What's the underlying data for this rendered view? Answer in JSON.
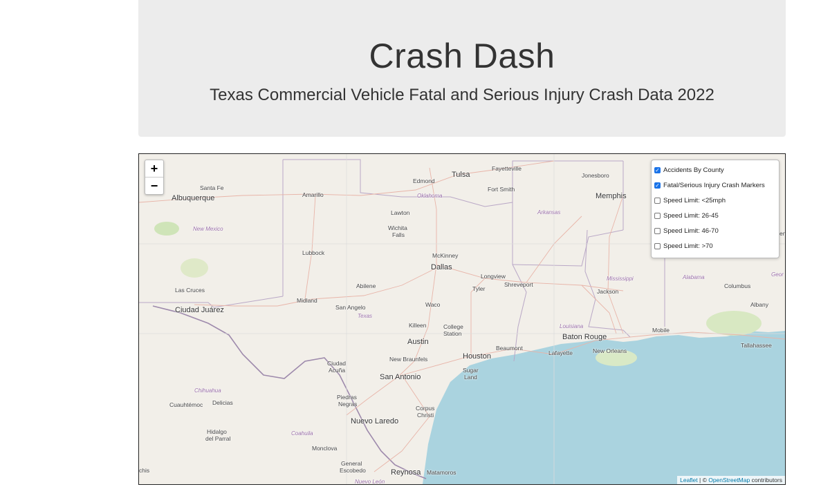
{
  "header": {
    "title": "Crash Dash",
    "subtitle": "Texas Commercial Vehicle Fatal and Serious Injury Crash Data 2022"
  },
  "map": {
    "zoom_in": "+",
    "zoom_out": "−",
    "layers": [
      {
        "label": "Accidents By County",
        "checked": true
      },
      {
        "label": "Fatal/Serious Injury Crash Markers",
        "checked": true
      },
      {
        "label": "Speed Limit: <25mph",
        "checked": false
      },
      {
        "label": "Speed Limit: 26-45",
        "checked": false
      },
      {
        "label": "Speed Limit: 46-70",
        "checked": false
      },
      {
        "label": "Speed Limit: >70",
        "checked": false
      }
    ],
    "attribution": {
      "leaflet": "Leaflet",
      "sep": " | © ",
      "osm": "OpenStreetMap",
      "suffix": " contributors"
    },
    "places": {
      "fayetteville": "Fayetteville",
      "tulsa": "Tulsa",
      "edmond": "Edmond",
      "oklahoma": "Oklahoma",
      "fort_smith": "Fort Smith",
      "jonesboro": "Jonesboro",
      "memphis": "Memphis",
      "santa_fe": "Santa Fe",
      "albuquerque": "Albuquerque",
      "amarillo": "Amarillo",
      "new_mexico": "New Mexico",
      "lawton": "Lawton",
      "wichita_falls_1": "Wichita",
      "wichita_falls_2": "Falls",
      "arkansas": "Arkansas",
      "mckinney": "McKinney",
      "lubbock": "Lubbock",
      "dallas": "Dallas",
      "longview": "Longview",
      "shreveport": "Shreveport",
      "mississippi": "Mississippi",
      "alabama": "Alabama",
      "las_cruces": "Las Cruces",
      "abilene": "Abilene",
      "tyler": "Tyler",
      "jackson": "Jackson",
      "columbus": "Columbus",
      "midland": "Midland",
      "ciudad_juarez": "Ciudad Juárez",
      "san_angelo": "San Angelo",
      "waco": "Waco",
      "texas": "Texas",
      "albany": "Albany",
      "killeen": "Killeen",
      "college_station_1": "College",
      "college_station_2": "Station",
      "louisiana": "Louisiana",
      "mobile": "Mobile",
      "baton_rouge": "Baton Rouge",
      "tallahassee": "Tallahassee",
      "austin": "Austin",
      "beaumont": "Beaumont",
      "lafayette": "Lafayette",
      "new_orleans": "New Orleans",
      "ciudad_acuna_1": "Ciudad",
      "ciudad_acuna_2": "Acuña",
      "new_braunfels": "New Braunfels",
      "houston": "Houston",
      "sugar_land_1": "Sugar",
      "sugar_land_2": "Land",
      "san_antonio": "San Antonio",
      "chihuahua": "Chihuahua",
      "cuauhtemoc": "Cuauhtémoc",
      "delicias": "Delicias",
      "piedras_negras_1": "Piedras",
      "piedras_negras_2": "Negras",
      "corpus_christi_1": "Corpus",
      "corpus_christi_2": "Christi",
      "nuevo_laredo": "Nuevo Laredo",
      "coahuila": "Coahuila",
      "hidalgo_1": "Hidalgo",
      "hidalgo_2": "del Parral",
      "monclova": "Monclova",
      "general_1": "General",
      "general_2": "Escobedo",
      "nuevo_leon": "Nuevo León",
      "reynosa": "Reynosa",
      "matamoros": "Matamoros",
      "chis": "chis",
      "georgia": "Geor",
      "edge_en": "en"
    }
  }
}
